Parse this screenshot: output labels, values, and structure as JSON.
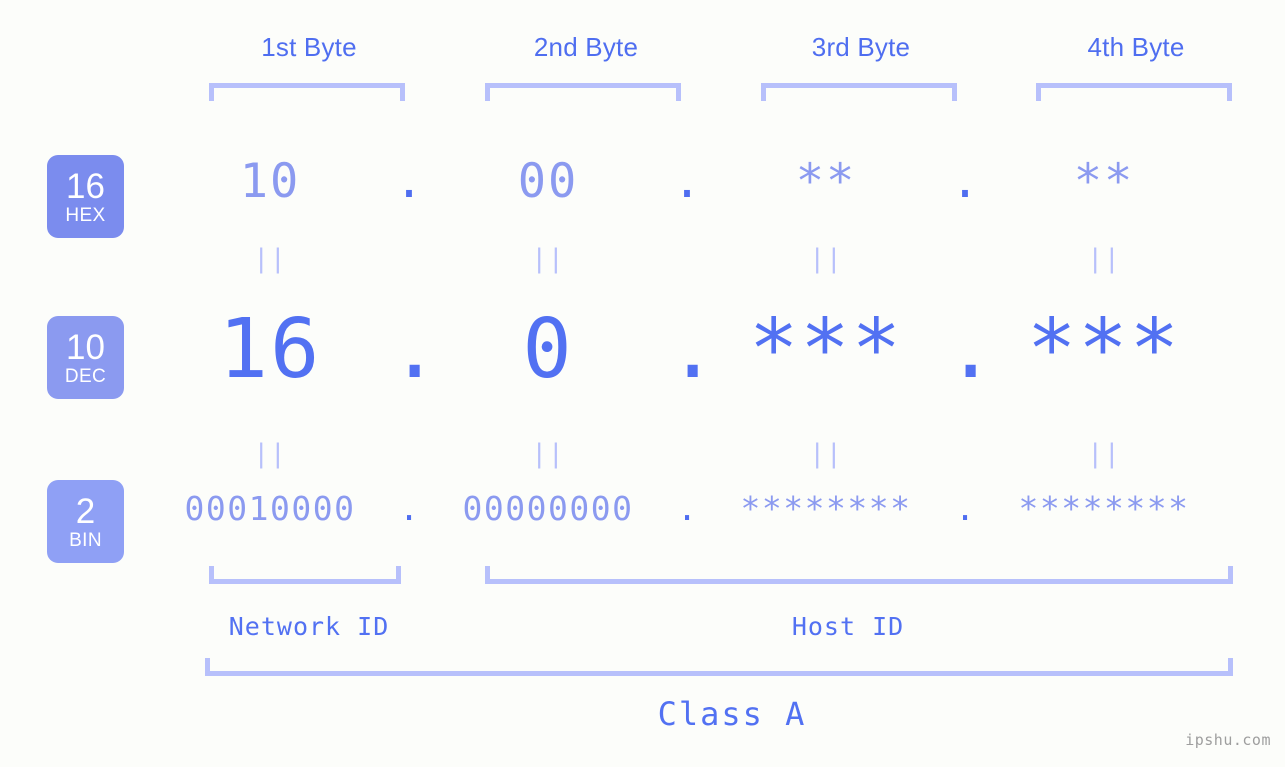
{
  "background_color": "#fcfdfa",
  "colors": {
    "accent_dark": "#5271f2",
    "accent_light": "#8b9af0",
    "bracket": "#b7c0fb",
    "badge_hex": "#7b8cee",
    "badge_dec": "#8b9af0",
    "badge_bin": "#8fa0f5",
    "watermark": "#9e9e9e"
  },
  "byte_headers": [
    {
      "label": "1st Byte"
    },
    {
      "label": "2nd Byte"
    },
    {
      "label": "3rd Byte"
    },
    {
      "label": "4th Byte"
    }
  ],
  "bases": [
    {
      "id": "hex",
      "number": "16",
      "name": "HEX"
    },
    {
      "id": "dec",
      "number": "10",
      "name": "DEC"
    },
    {
      "id": "bin",
      "number": "2",
      "name": "BIN"
    }
  ],
  "rows": {
    "hex": {
      "values": [
        "10",
        "00",
        "**",
        "**"
      ],
      "separator": "."
    },
    "dec": {
      "values": [
        "16",
        "0",
        "***",
        "***"
      ],
      "separator": "."
    },
    "bin": {
      "values": [
        "00010000",
        "00000000",
        "********",
        "********"
      ],
      "separator": "."
    }
  },
  "connectors": {
    "symbol": "||"
  },
  "segments": [
    {
      "label": "Network ID"
    },
    {
      "label": "Host ID"
    }
  ],
  "class": {
    "label": "Class A"
  },
  "watermark": {
    "text": "ipshu.com"
  }
}
